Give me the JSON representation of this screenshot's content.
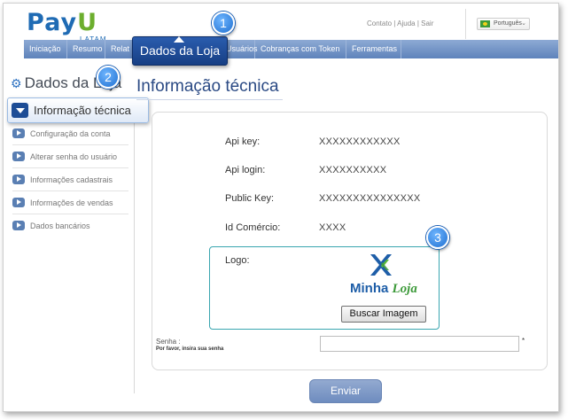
{
  "brand": {
    "logo_pay": "Pay",
    "logo_u": "U",
    "logo_sub": "LATAM"
  },
  "toplinks": {
    "contato": "Contato",
    "ajuda": "Ajuda",
    "sair": "Sair",
    "sep": "|"
  },
  "language": {
    "selected": "Português"
  },
  "nav": {
    "items": [
      "Iniciação",
      "Resumo",
      "Relat",
      "Usuários",
      "Cobranças com Token",
      "Ferramentas"
    ]
  },
  "callouts": {
    "dados_loja": "Dados da Loja",
    "badge1": "1",
    "badge2": "2",
    "badge3": "3"
  },
  "sidebar": {
    "heading": "Dados da Loja",
    "selected": "Informação técnica",
    "items": [
      "Configuração da conta",
      "Alterar senha do usuário",
      "Informações cadastrais",
      "Informações de vendas",
      "Dados bancários"
    ]
  },
  "page": {
    "title": "Informação técnica"
  },
  "fields": [
    {
      "label": "Api key:",
      "value": "XXXXXXXXXXXX"
    },
    {
      "label": "Api login:",
      "value": "XXXXXXXXXX"
    },
    {
      "label": "Public Key:",
      "value": "XXXXXXXXXXXXXXX"
    },
    {
      "label": "Id Comércio:",
      "value": "XXXX"
    }
  ],
  "logo_section": {
    "label": "Logo:",
    "brand_part1": "Minha",
    "brand_part2": "Loja",
    "button": "Buscar Imagem"
  },
  "senha": {
    "label": "Senha :",
    "hint": "Por favor, insira sua senha",
    "value": "",
    "required_mark": "*"
  },
  "submit": {
    "label": "Enviar"
  },
  "colors": {
    "nav_blue": "#6f91c5",
    "accent_blue": "#1f6bb4",
    "callout_blue": "#1f4a94",
    "logo_frame": "#3aa6b0"
  }
}
